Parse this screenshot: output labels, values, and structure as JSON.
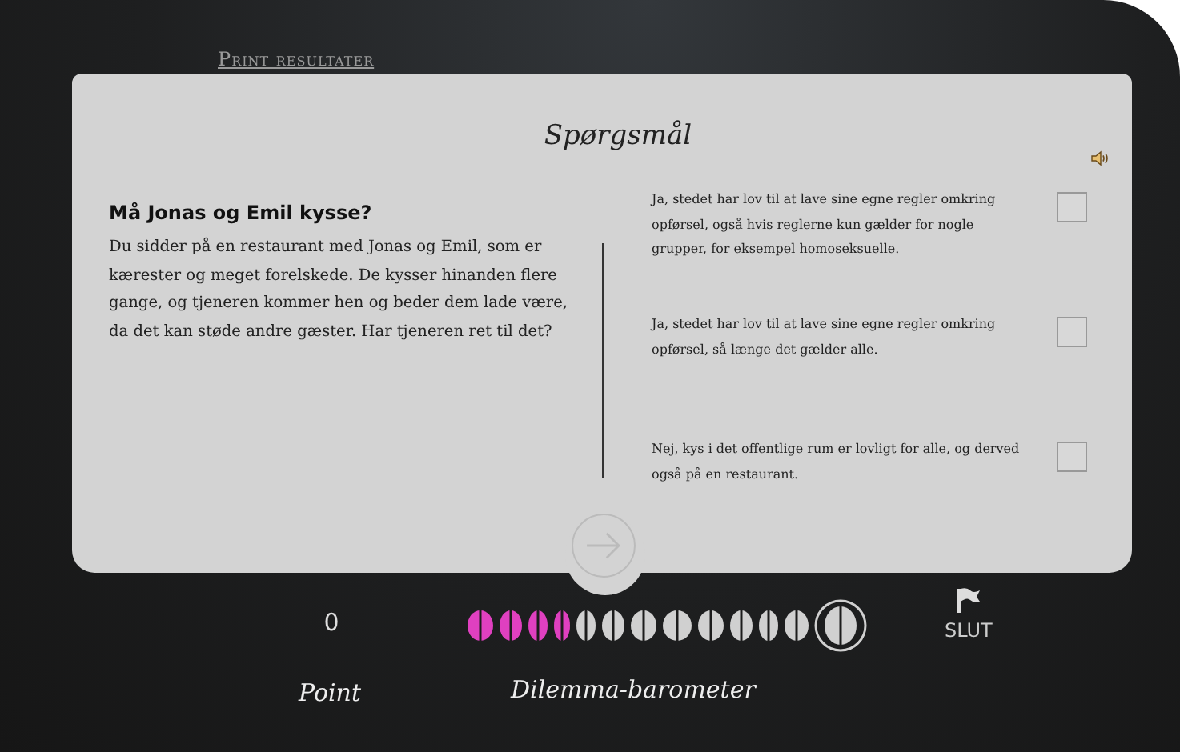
{
  "print_link": "Print resultater",
  "card": {
    "title": "Spørgsmål",
    "question": {
      "heading": "Må Jonas og Emil kysse?",
      "text": "Du sidder på en restaurant med Jonas og Emil, som er kærester og meget forelskede. De kysser hinanden flere gange, og tjeneren kommer hen og beder dem lade være, da det kan støde andre gæster. Har tjeneren ret til det?"
    },
    "answers": [
      {
        "text": "Ja, stedet har lov til at lave sine egne regler omkring opførsel, også hvis reglerne kun gælder for nogle grupper, for eksempel homoseksuelle.",
        "checked": false
      },
      {
        "text": "Ja, stedet har lov til at lave sine egne regler omkring opførsel, så længe det gælder alle.",
        "checked": false
      },
      {
        "text": "Nej, kys i det offentlige rum er lovligt for alle, og derved også på en restaurant.",
        "checked": false
      }
    ]
  },
  "score": {
    "value": "0",
    "label": "Point"
  },
  "barometer": {
    "label": "Dilemma-barometer",
    "segments": [
      {
        "filled": true,
        "selected": false
      },
      {
        "filled": true,
        "selected": false
      },
      {
        "filled": true,
        "selected": false
      },
      {
        "filled": true,
        "selected": false
      },
      {
        "filled": false,
        "selected": false
      },
      {
        "filled": false,
        "selected": false
      },
      {
        "filled": false,
        "selected": false
      },
      {
        "filled": false,
        "selected": false
      },
      {
        "filled": false,
        "selected": false
      },
      {
        "filled": false,
        "selected": false
      },
      {
        "filled": false,
        "selected": false
      },
      {
        "filled": false,
        "selected": false
      },
      {
        "filled": false,
        "selected": true
      }
    ]
  },
  "end_button": {
    "label": "SLUT"
  }
}
